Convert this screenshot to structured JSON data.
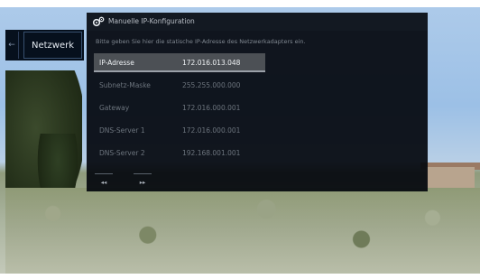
{
  "nav": {
    "prev_arrow": "←",
    "current": "Netzwerk"
  },
  "panel": {
    "title": "Manuelle IP-Konfiguration",
    "description": "Bitte geben Sie hier die statische IP-Adresse des Netzwerkadapters ein.",
    "rows": [
      {
        "label": "IP-Adresse",
        "value": "172.016.013.048",
        "selected": true
      },
      {
        "label": "Subnetz-Maske",
        "value": "255.255.000.000",
        "selected": false
      },
      {
        "label": "Gateway",
        "value": "172.016.000.001",
        "selected": false
      },
      {
        "label": "DNS-Server 1",
        "value": "172.016.000.001",
        "selected": false
      },
      {
        "label": "DNS-Server 2",
        "value": "192.168.001.001",
        "selected": false
      }
    ],
    "footer": {
      "rewind_symbol": "◂◂",
      "forward_symbol": "▸▸"
    }
  },
  "colors": {
    "panel_bg": "#04080e",
    "selected_row": "#4c5055",
    "nav_bg": "#06101d"
  }
}
